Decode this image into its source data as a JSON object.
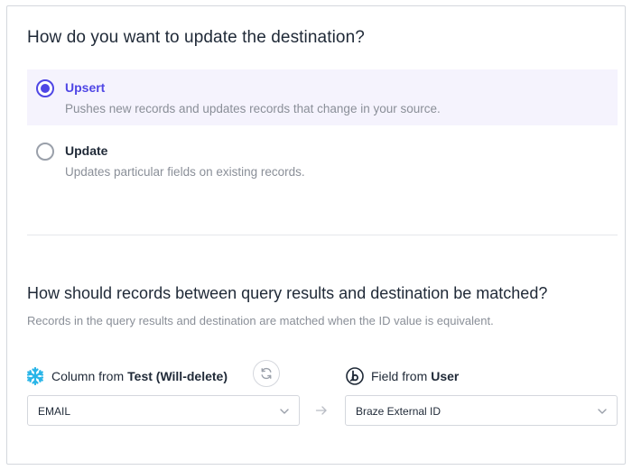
{
  "update_section": {
    "heading": "How do you want to update the destination?",
    "options": [
      {
        "label": "Upsert",
        "description": "Pushes new records and updates records that change in your source.",
        "selected": true
      },
      {
        "label": "Update",
        "description": "Updates particular fields on existing records.",
        "selected": false
      }
    ]
  },
  "match_section": {
    "heading": "How should records between query results and destination be matched?",
    "subheading": "Records in the query results and destination are matched when the ID value is equivalent.",
    "source": {
      "label_prefix": "Column from",
      "model_name": "Test (Will-delete)",
      "icon": "snowflake-icon",
      "selected_value": "EMAIL"
    },
    "destination": {
      "label_prefix": "Field from",
      "object_name": "User",
      "icon": "braze-logo-icon",
      "selected_value": "Braze External ID"
    }
  },
  "colors": {
    "accent": "#4f46e5",
    "selected_bg": "#f5f3fd",
    "snowflake": "#29b5e8",
    "muted_text": "#8a8f98",
    "border": "#d4d7dd"
  }
}
